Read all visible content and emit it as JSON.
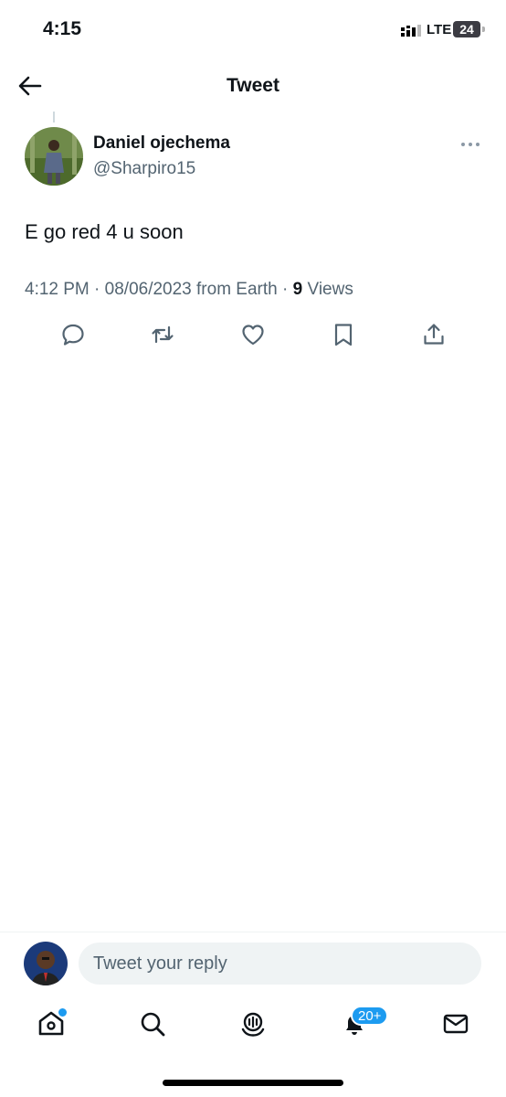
{
  "status_bar": {
    "time": "4:15",
    "network": "LTE",
    "battery": "24"
  },
  "header": {
    "title": "Tweet"
  },
  "tweet": {
    "display_name": "Daniel ojechema",
    "handle": "@Sharpiro15",
    "text": "E go red 4 u soon",
    "time": "4:12 PM",
    "date": "08/06/2023",
    "source": "from Earth",
    "views_count": "9",
    "views_label": "Views"
  },
  "actions": [
    "reply-icon",
    "retweet-icon",
    "like-icon",
    "bookmark-icon",
    "share-icon"
  ],
  "reply": {
    "placeholder": "Tweet your reply"
  },
  "bottom_nav": {
    "items": [
      "home-icon",
      "search-icon",
      "spaces-icon",
      "notifications-icon",
      "messages-icon"
    ],
    "notifications_badge": "20+"
  },
  "colors": {
    "accent": "#1d9bf0",
    "text": "#0f1419",
    "secondary": "#536471"
  }
}
